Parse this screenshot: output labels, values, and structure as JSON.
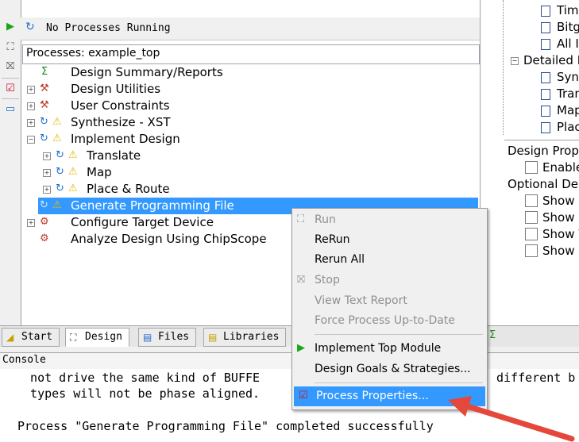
{
  "status": {
    "text": "No Processes Running"
  },
  "tree": {
    "header": "Processes: example_top",
    "items": [
      "Design Summary/Reports",
      "Design Utilities",
      "User Constraints",
      "Synthesize - XST",
      "Implement Design",
      "Translate",
      "Map",
      "Place & Route",
      "Generate Programming File",
      "Configure Target Device",
      "Analyze Design Using ChipScope"
    ]
  },
  "right_panel": {
    "reports": [
      "Timi",
      "Bitg",
      "All I"
    ],
    "detailed_label": "Detailed R",
    "detailed": [
      "Synt",
      "Tran",
      "Map",
      "Plac"
    ],
    "props_header": "Design Prope",
    "enable_label": "Enable",
    "optional_header": "Optional Des",
    "show_items": [
      "Show C",
      "Show F",
      "Show V",
      "Show E"
    ]
  },
  "tabs": [
    "Start",
    "Design",
    "Files",
    "Libraries"
  ],
  "console": {
    "title": "Console",
    "lines": [
      "  not drive the same kind of BUFFE",
      "  types will not be phase aligned.",
      "",
      "Process \"Generate Programming File\" completed successfully"
    ],
    "partial_right": "different b"
  },
  "context_menu": {
    "items": [
      {
        "label": "Run",
        "disabled": true
      },
      {
        "label": "ReRun",
        "disabled": false
      },
      {
        "label": "Rerun All",
        "disabled": false
      },
      {
        "label": "Stop",
        "disabled": true
      },
      {
        "label": "View Text Report",
        "disabled": true
      },
      {
        "label": "Force Process Up-to-Date",
        "disabled": true
      },
      {
        "label": "Implement Top Module",
        "disabled": false
      },
      {
        "label": "Design Goals & Strategies...",
        "disabled": false
      },
      {
        "label": "Process Properties...",
        "disabled": false,
        "highlighted": true
      }
    ]
  },
  "colors": {
    "selection": "#3399ff",
    "arrow": "#e5473a"
  }
}
